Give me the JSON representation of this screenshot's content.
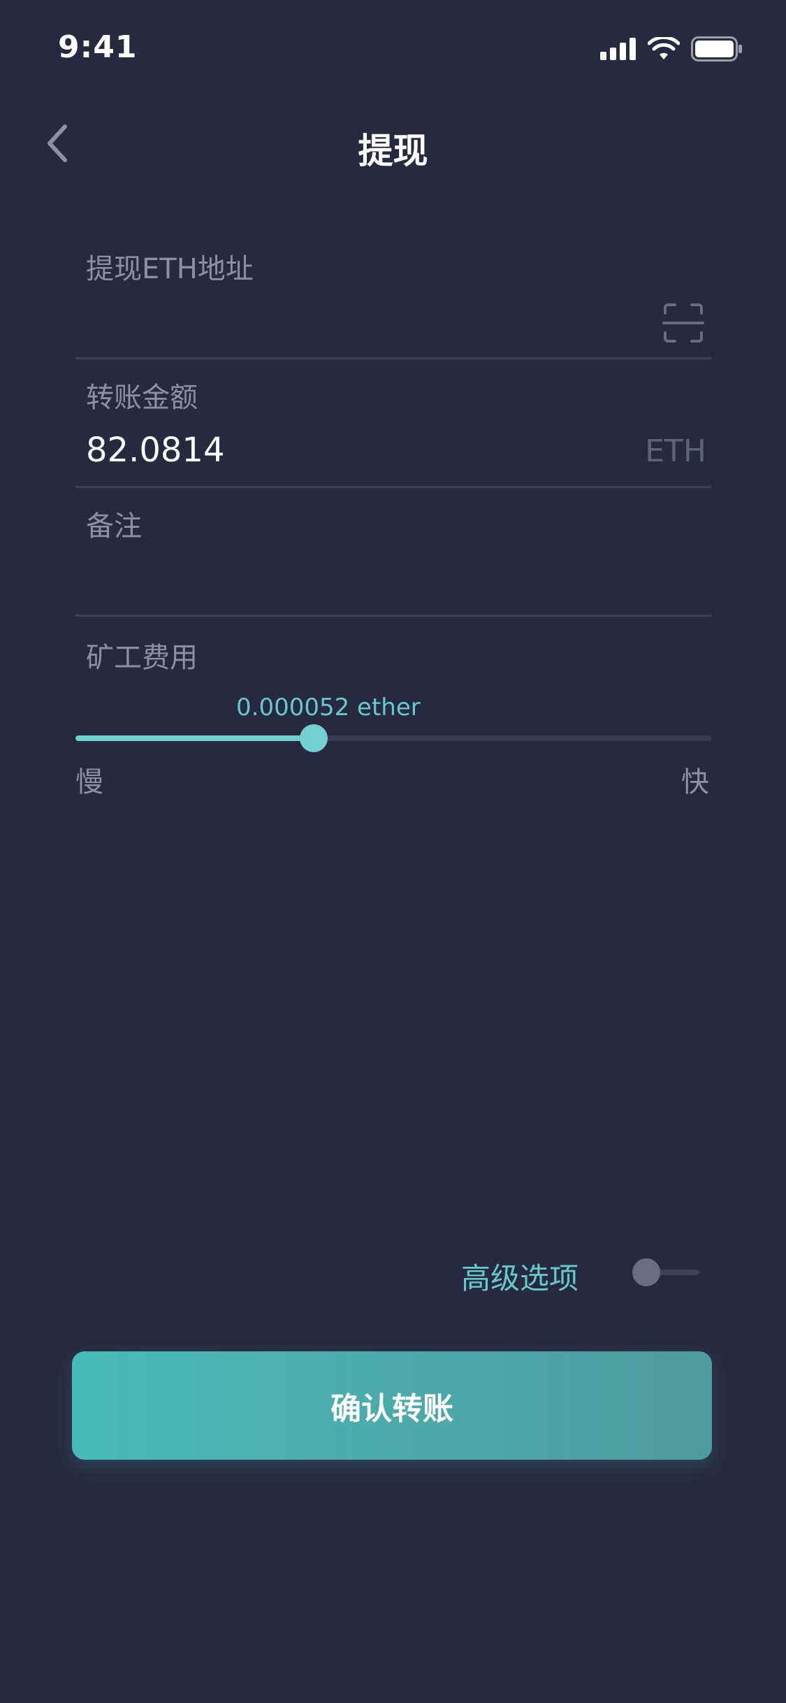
{
  "status_bar": {
    "time": "9:41",
    "icons": [
      "signal-icon",
      "wifi-icon",
      "battery-icon"
    ]
  },
  "nav": {
    "back_icon": "chevron-left-icon",
    "title": "提现"
  },
  "form": {
    "address": {
      "label": "提现ETH地址",
      "value": "",
      "scan_icon": "scan-icon"
    },
    "amount": {
      "label": "转账金额",
      "value": "82.0814",
      "unit": "ETH"
    },
    "memo": {
      "label": "备注",
      "value": ""
    }
  },
  "fee": {
    "label": "矿工费用",
    "value_text": "0.000052 ether",
    "level": 0.375,
    "min_label": "慢",
    "max_label": "快"
  },
  "advanced": {
    "label": "高级选项",
    "enabled": false
  },
  "confirm_button": {
    "label": "确认转账"
  },
  "colors": {
    "background": "#272a3e",
    "accent": "#66c9c9",
    "muted": "#8d90a3",
    "button_start": "#48bbb9",
    "button_end": "#4e9a9c"
  }
}
